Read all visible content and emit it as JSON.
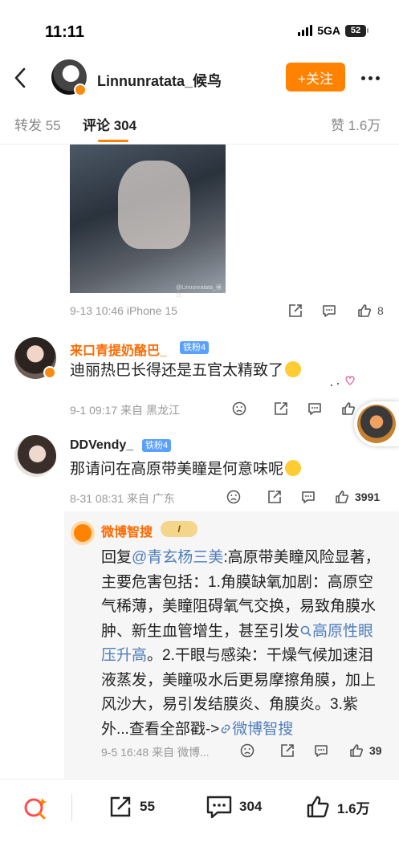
{
  "status_bar": {
    "time": "11:11",
    "network": "5GA",
    "battery": "52"
  },
  "header": {
    "username": "Linnunratata_候鸟",
    "follow_label": "+关注"
  },
  "tabs": {
    "repost": "转发 55",
    "comments": "评论 304",
    "likes": "赞 1.6万"
  },
  "post": {
    "watermark": "@Linnunratata_候鸟",
    "time": "9-13 10:46",
    "device": "iPhone 15",
    "like_count": "8"
  },
  "comments": [
    {
      "name": "来口青提奶酪巴_",
      "fan_badge": "铁粉4",
      "text": "迪丽热巴长得还是五官太精致了",
      "emoji": "😂",
      "date": "9-1 09:17",
      "location": "来自 黑龙江"
    },
    {
      "name": "DDVendy_",
      "fan_badge": "铁粉4",
      "text": "那请问在高原带美瞳是何意味呢",
      "emoji": "🥹",
      "date": "8-31 08:31",
      "location": "来自 广东",
      "like_count": "3991"
    }
  ],
  "reply": {
    "name": "微博智搜",
    "level": "I",
    "prefix": "回复",
    "mention": "@青玄杨三美",
    "text_1": ":高原带美瞳风险显著，主要危害包括：1.角膜缺氧加剧：高原空气稀薄，美瞳阻碍氧气交换，易致角膜水肿、新生血管增生，甚至引发",
    "search_link": "高原性眼压升高",
    "text_2": "。2.干眼与感染：干燥气候加速泪液蒸发，美瞳吸水后更易摩擦角膜，加上风沙大，易引发结膜炎、角膜炎。3.紫外...查看全部戳->",
    "source_link": "微博智搜",
    "date": "9-5 16:48",
    "location": "来自 微博...",
    "like_count": "39"
  },
  "bottom_bar": {
    "repost_count": "55",
    "comment_count": "304",
    "like_count": "1.6万"
  },
  "colors": {
    "accent": "#ff8200",
    "link": "#4f7dbd",
    "name_orange": "#ff6a00",
    "fan_badge": "#5aa0ff"
  }
}
